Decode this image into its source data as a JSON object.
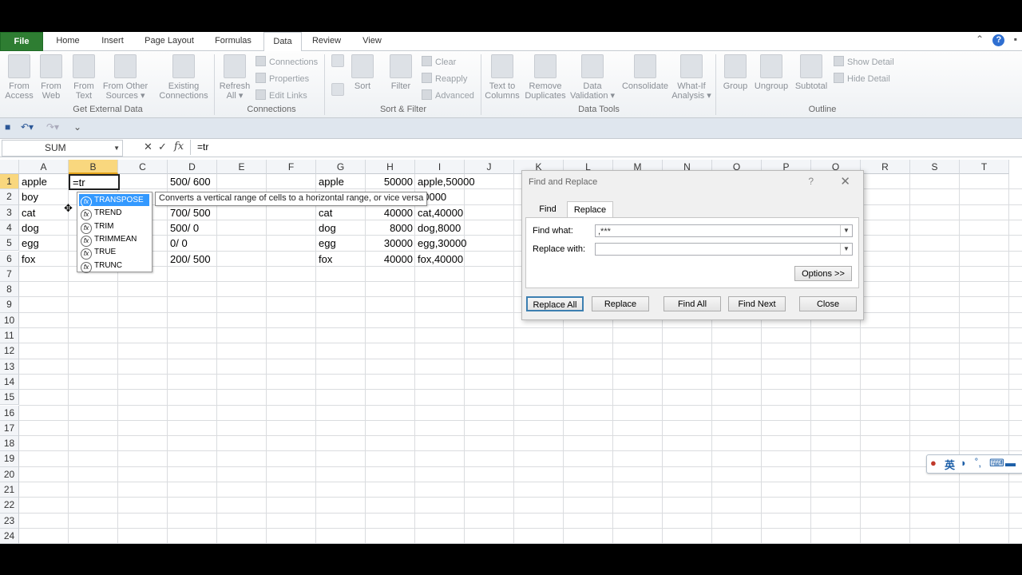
{
  "tabs": [
    "File",
    "Home",
    "Insert",
    "Page Layout",
    "Formulas",
    "Data",
    "Review",
    "View"
  ],
  "active_tab": "Data",
  "ribbon": {
    "get_external": {
      "group_label": "Get External Data",
      "from_access": [
        "From",
        "Access"
      ],
      "from_web": [
        "From",
        "Web"
      ],
      "from_text": [
        "From",
        "Text"
      ],
      "from_other": [
        "From Other",
        "Sources ▾"
      ],
      "existing": [
        "Existing",
        "Connections"
      ]
    },
    "connections": {
      "group_label": "Connections",
      "refresh": [
        "Refresh",
        "All ▾"
      ],
      "connections": "Connections",
      "properties": "Properties",
      "edit_links": "Edit Links"
    },
    "sort_filter": {
      "group_label": "Sort & Filter",
      "sort": "Sort",
      "filter": "Filter",
      "clear": "Clear",
      "reapply": "Reapply",
      "advanced": "Advanced"
    },
    "data_tools": {
      "group_label": "Data Tools",
      "text_to_columns": [
        "Text to",
        "Columns"
      ],
      "remove_duplicates": [
        "Remove",
        "Duplicates"
      ],
      "data_validation": [
        "Data",
        "Validation ▾"
      ],
      "consolidate": "Consolidate",
      "what_if": [
        "What-If",
        "Analysis ▾"
      ]
    },
    "outline": {
      "group_label": "Outline",
      "group": "Group",
      "ungroup": "Ungroup",
      "subtotal": "Subtotal",
      "show_detail": "Show Detail",
      "hide_detail": "Hide Detail"
    }
  },
  "formula_bar": {
    "name_box": "SUM",
    "formula": "=tr"
  },
  "columns": [
    "A",
    "B",
    "C",
    "D",
    "E",
    "F",
    "G",
    "H",
    "I",
    "J",
    "K",
    "L",
    "M",
    "N",
    "O",
    "P",
    "Q",
    "R",
    "S",
    "T"
  ],
  "rows": [
    "1",
    "2",
    "3",
    "4",
    "5",
    "6",
    "7",
    "8",
    "9",
    "10",
    "11",
    "12",
    "13",
    "14",
    "15",
    "16",
    "17",
    "18",
    "19",
    "20",
    "21",
    "22",
    "23",
    "24"
  ],
  "cells": {
    "A": [
      "apple",
      "boy",
      "cat",
      "dog",
      "egg",
      "fox"
    ],
    "D": [
      "500/ 600",
      "",
      "700/ 500",
      "500/ 0",
      "0/ 0",
      "200/ 500"
    ],
    "G": [
      "apple",
      "",
      "cat",
      "dog",
      "egg",
      "fox"
    ],
    "H": [
      "50000",
      "",
      "40000",
      "8000",
      "30000",
      "40000"
    ],
    "I": [
      "apple,50000",
      "30000",
      "cat,40000",
      "dog,8000",
      "egg,30000",
      "fox,40000"
    ]
  },
  "active_cell_text": "=tr",
  "autocomplete": {
    "items": [
      "TRANSPOSE",
      "TREND",
      "TRIM",
      "TRIMMEAN",
      "TRUE",
      "TRUNC"
    ],
    "selected_index": 0,
    "tooltip": "Converts a vertical range of cells to a horizontal range, or vice versa"
  },
  "dialog": {
    "title": "Find and Replace",
    "help": "?",
    "close": "✕",
    "tabs": [
      "Find",
      "Replace"
    ],
    "active_tab": "Replace",
    "find_label": "Find what:",
    "find_value": ",***",
    "replace_label": "Replace with:",
    "replace_value": "",
    "options_button": "Options >>",
    "buttons": {
      "replace_all": "Replace All",
      "replace": "Replace",
      "find_all": "Find All",
      "find_next": "Find Next",
      "close": "Close"
    }
  },
  "ime": {
    "lang": "英"
  },
  "colors": {
    "file_tab": "#2e7d32",
    "selected_header": "#f9d77e",
    "autocomplete_highlight": "#3399ff"
  }
}
